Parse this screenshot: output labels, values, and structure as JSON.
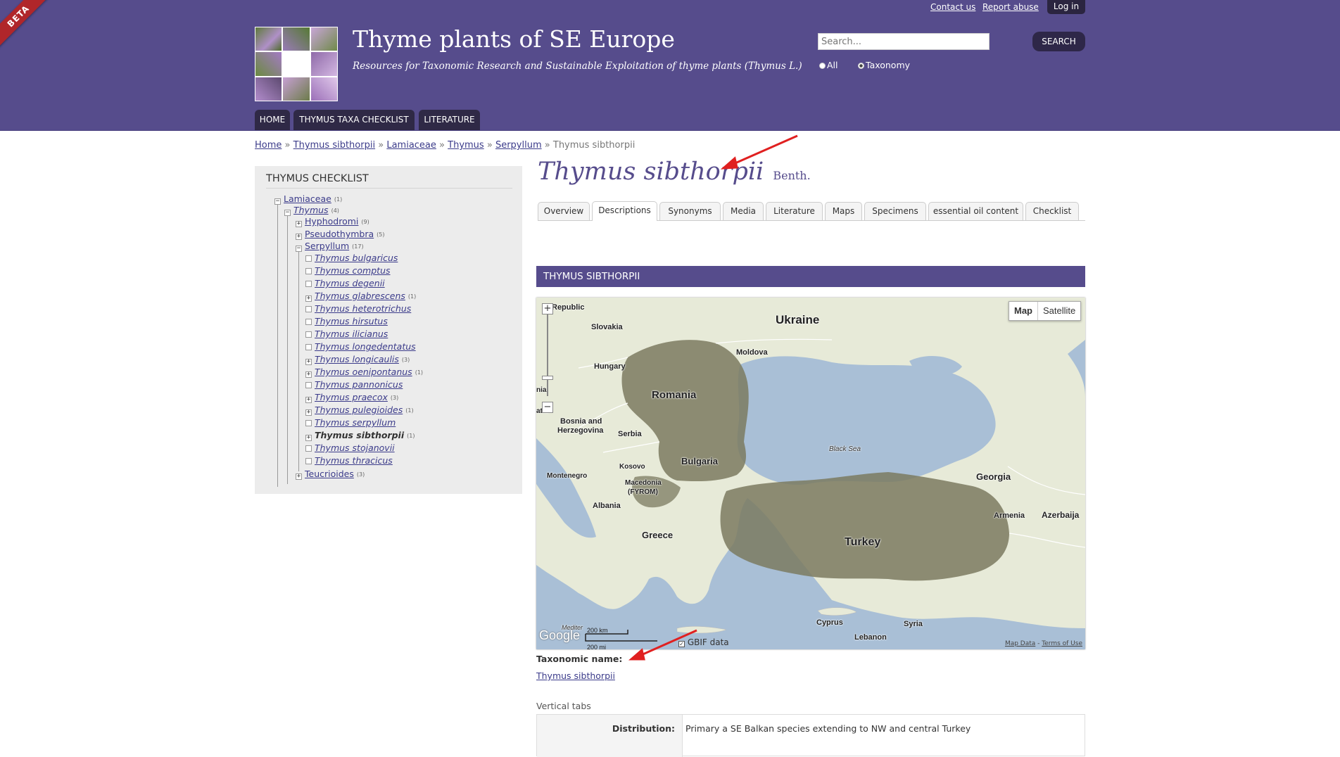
{
  "header": {
    "beta": "BETA",
    "site_name": "Thyme plants of SE Europe",
    "slogan": "Resources for Taxonomic Research and Sustainable Exploitation of thyme plants (Thymus L.)",
    "top_links": {
      "contact": "Contact us",
      "report": "Report abuse",
      "login": "Log in"
    },
    "search": {
      "placeholder": "Search...",
      "button": "SEARCH",
      "radio_all": "All",
      "radio_taxonomy": "Taxonomy",
      "selected": "Taxonomy"
    },
    "menu": [
      "HOME",
      "THYMUS TAXA CHECKLIST",
      "LITERATURE"
    ]
  },
  "breadcrumb": {
    "items": [
      "Home",
      "Thymus sibthorpii",
      "Lamiaceae",
      "Thymus",
      "Serpyllum"
    ],
    "current": "Thymus sibthorpii",
    "sep": "»"
  },
  "sidebar": {
    "title": "THYMUS CHECKLIST",
    "tree": [
      {
        "label": "Lamiaceae",
        "count": "(1)",
        "toggle": "−"
      },
      {
        "label": "Thymus",
        "count": "(4)",
        "toggle": "−"
      },
      {
        "label": "Hyphodromi",
        "count": "(9)",
        "toggle": "+"
      },
      {
        "label": "Pseudothymbra",
        "count": "(5)",
        "toggle": "+"
      },
      {
        "label": "Serpyllum",
        "count": "(17)",
        "toggle": "−"
      },
      {
        "label": "Thymus bulgaricus",
        "count": "",
        "toggle": ""
      },
      {
        "label": "Thymus comptus",
        "count": "",
        "toggle": ""
      },
      {
        "label": "Thymus degenii",
        "count": "",
        "toggle": ""
      },
      {
        "label": "Thymus glabrescens",
        "count": "(1)",
        "toggle": "+"
      },
      {
        "label": "Thymus heterotrichus",
        "count": "",
        "toggle": ""
      },
      {
        "label": "Thymus hirsutus",
        "count": "",
        "toggle": ""
      },
      {
        "label": "Thymus ilicianus",
        "count": "",
        "toggle": ""
      },
      {
        "label": "Thymus longedentatus",
        "count": "",
        "toggle": ""
      },
      {
        "label": "Thymus longicaulis",
        "count": "(3)",
        "toggle": "+"
      },
      {
        "label": "Thymus oenipontanus",
        "count": "(1)",
        "toggle": "+"
      },
      {
        "label": "Thymus pannonicus",
        "count": "",
        "toggle": ""
      },
      {
        "label": "Thymus praecox",
        "count": "(3)",
        "toggle": "+"
      },
      {
        "label": "Thymus pulegioides",
        "count": "(1)",
        "toggle": "+"
      },
      {
        "label": "Thymus serpyllum",
        "count": "",
        "toggle": ""
      },
      {
        "label": "Thymus sibthorpii",
        "count": "(1)",
        "toggle": "+"
      },
      {
        "label": "Thymus stojanovii",
        "count": "",
        "toggle": ""
      },
      {
        "label": "Thymus thracicus",
        "count": "",
        "toggle": ""
      },
      {
        "label": "Teucrioides",
        "count": "(3)",
        "toggle": "+"
      }
    ]
  },
  "content": {
    "title": "Thymus sibthorpii",
    "author": "Benth.",
    "tabs": [
      "Overview",
      "Descriptions",
      "Synonyms",
      "Media",
      "Literature",
      "Maps",
      "Specimens",
      "essential oil content",
      "Checklist"
    ],
    "active_tab": "Descriptions",
    "section_title": "THYMUS SIBTHORPII",
    "map": {
      "type_buttons": [
        "Map",
        "Satellite"
      ],
      "selected_type": "Map",
      "labels": {
        "ukraine": "Ukraine",
        "romania": "Romania",
        "moldova": "Moldova",
        "hungary": "Hungary",
        "slovakia": "Slovakia",
        "republic": "Republic",
        "bosnia": "Bosnia and",
        "herzegovina": "Herzegovina",
        "serbia": "Serbia",
        "bulgaria": "Bulgaria",
        "black_sea": "Black Sea",
        "georgia": "Georgia",
        "montenegro": "Montenegro",
        "kosovo": "Kosovo",
        "macedonia": "Macedonia",
        "fyrom": "(FYROM)",
        "albania": "Albania",
        "greece": "Greece",
        "turkey": "Turkey",
        "armenia": "Armenia",
        "azerbaija": "Azerbaija",
        "cyprus": "Cyprus",
        "lebanon": "Lebanon",
        "syria": "Syria",
        "mediterranean": "Mediter",
        "nia": "nia",
        "atia": "atia"
      },
      "google": "Google",
      "scale_km": "200 km",
      "scale_mi": "200 mi",
      "gbif_label": "GBIF data",
      "gbif_checked": true,
      "map_data": "Map Data",
      "terms": "Terms of Use",
      "colors": {
        "water": "#a9bfd6",
        "land": "#e7ead8",
        "range": "#7b7a60"
      }
    },
    "taxonomic_name_label": "Taxonomic name:",
    "taxonomic_name": "Thymus sibthorpii",
    "vertical_tabs_label": "Vertical tabs",
    "distribution_label": "Distribution:",
    "distribution_value": "Primary a SE Balkan species extending to NW and central Turkey"
  },
  "colors": {
    "header": "#564c8c",
    "menu_tab": "#2f2946",
    "link": "#3b3b8a",
    "beta": "#b0262a",
    "arrow": "#e02020"
  }
}
